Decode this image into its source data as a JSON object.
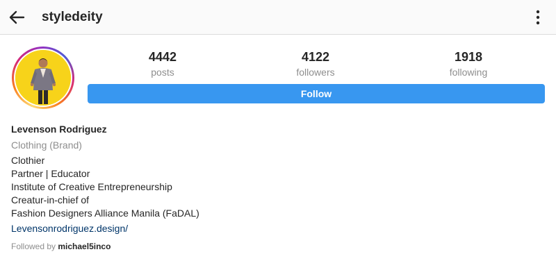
{
  "header": {
    "username": "styledeity",
    "back_icon": "arrow-left-icon",
    "more_icon": "more-vertical-icon"
  },
  "profile": {
    "avatar_icon": "profile-photo",
    "stats": {
      "posts": {
        "value": "4442",
        "label": "posts"
      },
      "followers": {
        "value": "4122",
        "label": "followers"
      },
      "following": {
        "value": "1918",
        "label": "following"
      }
    },
    "follow_label": "Follow",
    "follow_color": "#3897f0"
  },
  "bio": {
    "full_name": "Levenson Rodriguez",
    "category": "Clothing (Brand)",
    "lines": [
      "Clothier",
      "Partner | Educator",
      "Institute of Creative Entrepreneurship",
      "Creatur-in-chief of",
      "Fashion Designers Alliance Manila (FaDAL)"
    ],
    "website": "Levensonrodriguez.design/",
    "followed_by_prefix": "Followed by",
    "followed_by_user": "michael5inco"
  }
}
